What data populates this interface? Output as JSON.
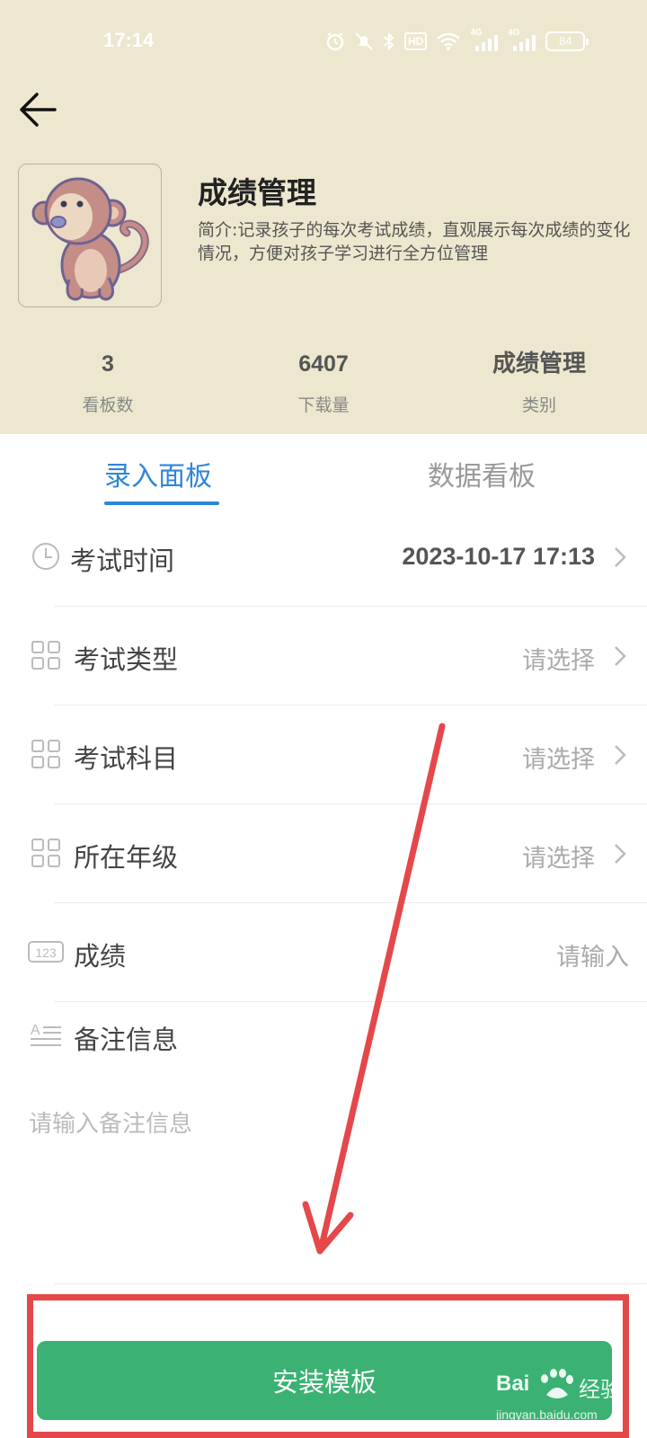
{
  "status_bar": {
    "time": "17:14",
    "battery": "84",
    "network_1": "4G",
    "network_2": "4G",
    "hd_badge": "HD",
    "icons": [
      "alarm-icon",
      "mute-icon",
      "bluetooth-icon",
      "hd-icon",
      "wifi-icon",
      "signal-4g-icon",
      "signal-4g-icon",
      "battery-icon"
    ],
    "color": "#ffffff"
  },
  "header": {
    "background": "#ECE7CE",
    "back_icon": "arrow-left-icon",
    "title": "成绩管理",
    "description": "简介:记录孩子的每次考试成绩，直观展示每次成绩的变化情况，方便对孩子学习进行全方位管理",
    "avatar": "monkey-illustration",
    "stats": [
      {
        "value": "3",
        "label": "看板数"
      },
      {
        "value": "6407",
        "label": "下载量"
      },
      {
        "value": "成绩管理",
        "label": "类别"
      }
    ]
  },
  "tabs": [
    {
      "label": "录入面板",
      "active": true
    },
    {
      "label": "数据看板",
      "active": false
    }
  ],
  "accent_color": "#2F86D8",
  "form": {
    "fields": [
      {
        "icon": "clock-icon",
        "label": "考试时间",
        "value": "2023-10-17 17:13",
        "filled": true
      },
      {
        "icon": "grid-icon",
        "label": "考试类型",
        "value": "请选择",
        "filled": false
      },
      {
        "icon": "grid-icon",
        "label": "考试科目",
        "value": "请选择",
        "filled": false
      },
      {
        "icon": "grid-icon",
        "label": "所在年级",
        "value": "请选择",
        "filled": false
      },
      {
        "icon": "number-icon",
        "label": "成绩",
        "value": "请输入",
        "filled": false
      },
      {
        "icon": "text-icon",
        "label": "备注信息",
        "placeholder": "请输入备注信息"
      }
    ]
  },
  "install_button": {
    "label": "安装模板",
    "color": "#3BB273"
  },
  "annotation": {
    "color": "#E5484A",
    "shapes": [
      "arrow",
      "highlight-box"
    ]
  },
  "watermark": {
    "brand": "Bai",
    "brand_cn": "经验",
    "url": "jingyan.baidu.com"
  }
}
